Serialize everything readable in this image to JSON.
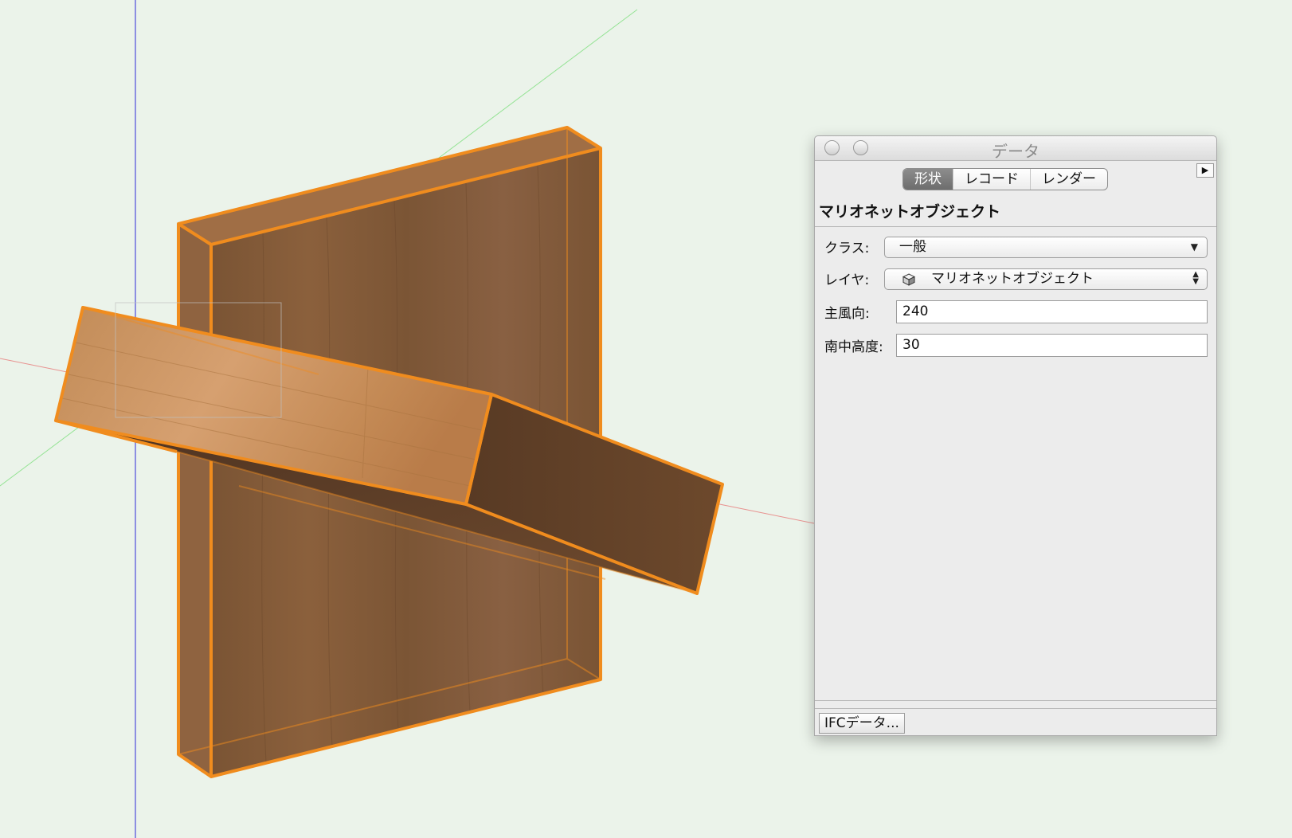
{
  "palette": {
    "title": "データ",
    "tabs": [
      "形状",
      "レコード",
      "レンダー"
    ],
    "active_tab": "形状",
    "object_type": "マリオネットオブジェクト",
    "fields": {
      "class_label": "クラス:",
      "class_value": "一般",
      "layer_label": "レイヤ:",
      "layer_value": "マリオネットオブジェクト",
      "wind_label": "主風向:",
      "wind_value": "240",
      "sun_label": "南中高度:",
      "sun_value": "30"
    },
    "ifc_button": "IFCデータ..."
  },
  "colors": {
    "background": "#ebf3ea",
    "selection_outline": "#f08c1e",
    "wood_dark": "#7d5636",
    "wood_light": "#c98d55",
    "axis_x": "#e8918f",
    "axis_y": "#94e394",
    "axis_z": "#6d6dde"
  },
  "icons": {
    "close": "close-icon",
    "minimize": "minimize-icon",
    "palette_menu": "triangle-right-icon",
    "popup_arrow": "chevron-down-icon",
    "layer_icon": "cube-icon"
  }
}
